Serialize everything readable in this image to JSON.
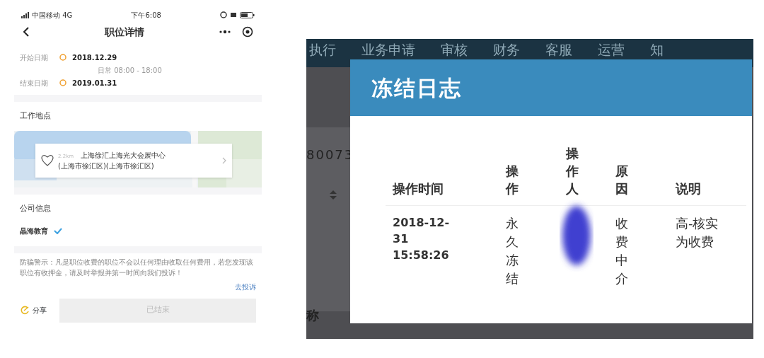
{
  "phone": {
    "status_bar": {
      "carrier": "中国移动 4G",
      "time": "下午6:08"
    },
    "nav": {
      "title": "职位详情"
    },
    "dates": [
      {
        "label": "开始日期",
        "value": "2018.12.29",
        "note": "日常 08:00 - 18:00"
      },
      {
        "label": "结束日期",
        "value": "2019.01.31"
      }
    ],
    "location": {
      "heading": "工作地点",
      "distance": "2.2km",
      "name": "上海徐汇上海光大会展中心",
      "address": "(上海市徐汇区)(上海市徐汇区)"
    },
    "company": {
      "heading": "公司信息",
      "name": "晶海教育",
      "verified": true
    },
    "notice": {
      "text": "防骗警示：凡是职位收费的职位不会以任何理由收取任何费用，若您发现该职位有收押金，请及时举报并第一时间向我们投诉！",
      "link": "去投诉"
    },
    "footer": {
      "share": "分享",
      "action": "已结束",
      "action_disabled": true
    }
  },
  "admin": {
    "nav": [
      "执行",
      "业务申请",
      "审核",
      "财务",
      "客服",
      "运营",
      "知"
    ],
    "background_texts": [
      "80073",
      "称"
    ],
    "modal": {
      "title": "冻结日志",
      "columns": [
        "操作时间",
        "操作",
        "操作人",
        "原因",
        "说明"
      ],
      "rows": [
        {
          "time": "2018-12-31 15:58:26",
          "action": "永久冻结",
          "operator_redacted": true,
          "reason": "收费中介",
          "note": "高-核实为收费"
        }
      ]
    }
  }
}
